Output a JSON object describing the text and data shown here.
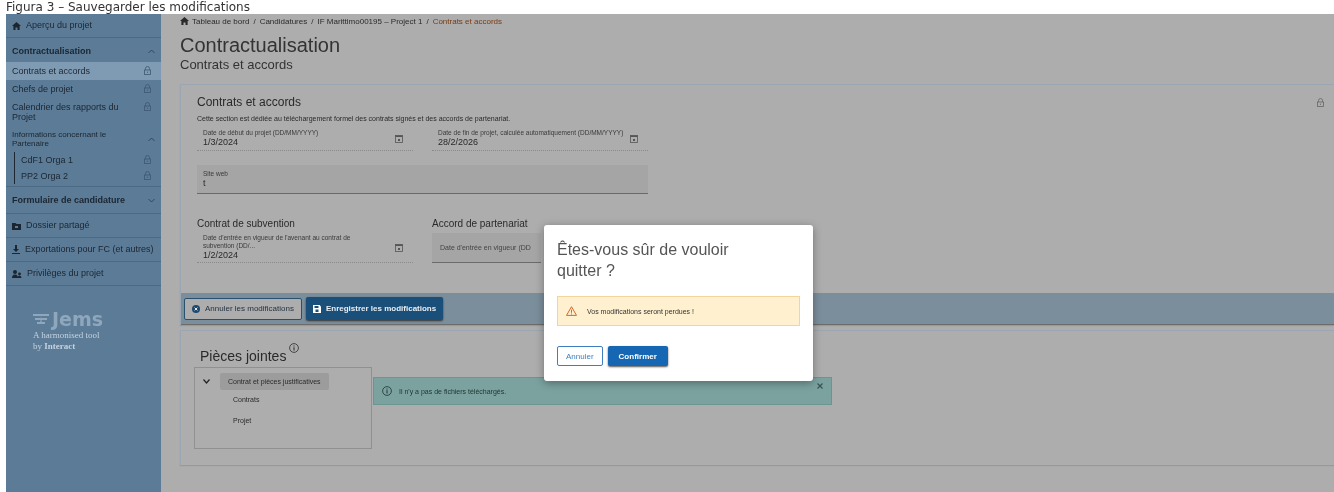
{
  "caption": "Figura 3 – Sauvegarder les modifications",
  "sidebar": {
    "items": [
      {
        "kind": "link",
        "label": "Aperçu du projet"
      },
      {
        "kind": "section",
        "label": "Contractualisation",
        "expanded": true,
        "children": [
          {
            "kind": "page",
            "label": "Contrats et accords",
            "selected": true,
            "locked": true
          },
          {
            "kind": "page",
            "label": "Chefs de projet",
            "selected": false,
            "locked": true
          },
          {
            "kind": "page",
            "label": "Calendrier des rapports du Projet",
            "selected": false,
            "locked": true
          },
          {
            "kind": "group",
            "label": "Informations concernant le Partenaire",
            "expanded": true,
            "children": [
              {
                "kind": "page",
                "label": "CdF1 Orga 1",
                "selected": false,
                "locked": true
              },
              {
                "kind": "page",
                "label": "PP2 Orga 2",
                "selected": false,
                "locked": true
              }
            ]
          }
        ]
      },
      {
        "kind": "section",
        "label": "Formulaire de candidature",
        "expanded": false
      },
      {
        "kind": "link",
        "label": "Dossier partagé"
      },
      {
        "kind": "link",
        "label": "Exportations pour FC (et autres)"
      },
      {
        "kind": "link",
        "label": "Privilèges du projet"
      }
    ],
    "logo": {
      "name": "Jems",
      "tagline": [
        "A harmonised tool",
        "by **Interact**"
      ]
    }
  },
  "breadcrumb": [
    {
      "label": "Tableau de bord",
      "current": false
    },
    {
      "separator": "/",
      "label": "Candidatures",
      "current": false
    },
    {
      "separator": "/",
      "label": "IF Marittimo00195 – Project 1",
      "current": false
    },
    {
      "separator": "/",
      "label": "Contrats et accords",
      "current": true
    }
  ],
  "page": {
    "title": "Contractualisation",
    "subtitle": "Contrats et accords"
  },
  "contracts": {
    "title": "Contrats et accords",
    "locked": true,
    "description": "Cette section est dédiée au téléchargement formel des contrats signés et des accords de partenariat.",
    "dates": [
      {
        "label": "Date de début du projet (DD/MM/YYYY)",
        "value": "1/3/2024"
      },
      {
        "label": "Date de fin de projet, calculée automatiquement (DD/MM/YYYY)",
        "value": "28/2/2026"
      }
    ],
    "website": {
      "label": "Site web",
      "value": "t"
    },
    "groups": [
      {
        "title": "Contrat de subvention",
        "field": {
          "label": "Date d'entrée en vigueur de l'avenant au contrat de subvention (DD/...",
          "value": "1/2/2024"
        }
      },
      {
        "title": "Accord de partenariat",
        "field": {
          "placeholder": "Date d'entrée en vigueur (DD"
        }
      }
    ],
    "actions": [
      {
        "kind": "secondary",
        "label": "Annuler les modifications"
      },
      {
        "kind": "primary",
        "label": "Enregistrer les modifications"
      }
    ]
  },
  "attachments": {
    "title": "Pièces jointes",
    "tree": [
      {
        "label": "Contrat et pièces justificatives",
        "expanded": true,
        "selected": true,
        "children": [
          {
            "label": "Contrats",
            "selected": false
          },
          {
            "label": "Projet",
            "selected": false
          }
        ]
      }
    ],
    "alert": "Il n'y a pas de fichiers téléchargés."
  },
  "dialog": {
    "title": "Êtes-vous sûr de vouloir quitter ?",
    "warning": "Vos modifications seront perdues !",
    "buttons": [
      {
        "kind": "secondary",
        "label": "Annuler"
      },
      {
        "kind": "primary",
        "label": "Confirmer"
      }
    ]
  }
}
